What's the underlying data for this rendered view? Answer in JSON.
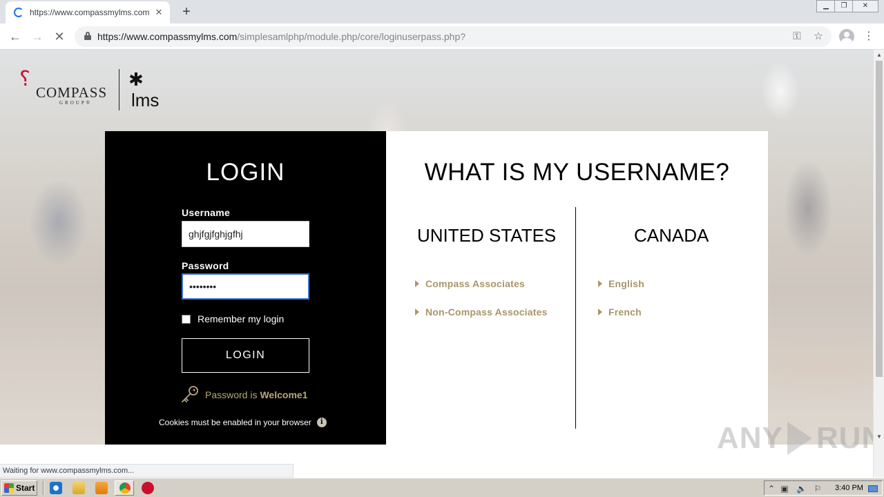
{
  "browser": {
    "tab_title": "https://www.compassmylms.com/simplesamlphp/module.php/core/loginuserpass.php?",
    "url_host": "https://www.compassmylms.com",
    "url_path": "/simplesamlphp/module.php/core/loginuserpass.php?",
    "status_text": "Waiting for www.compassmylms.com..."
  },
  "logo": {
    "company_word": "COMPASS",
    "company_sub": "GROUP®",
    "lms_word": "lms"
  },
  "login": {
    "title": "LOGIN",
    "username_label": "Username",
    "username_value": "ghjfgjfghjgfhj",
    "password_label": "Password",
    "password_value": "••••••••",
    "remember_label": "Remember my login",
    "button_label": "LOGIN",
    "hint_prefix": "Password is",
    "hint_value": "Welcome1",
    "cookies_text": "Cookies must be enabled in your browser"
  },
  "username_help": {
    "title": "WHAT IS MY USERNAME?",
    "regions": [
      {
        "name": "UNITED STATES",
        "links": [
          "Compass Associates",
          "Non-Compass Associates"
        ]
      },
      {
        "name": "CANADA",
        "links": [
          "English",
          "French"
        ]
      }
    ]
  },
  "watermark": {
    "left": "ANY",
    "right": "RUN"
  },
  "taskbar": {
    "start_label": "Start",
    "clock": "3:40 PM"
  },
  "colors": {
    "accent_gold": "#a8956a",
    "login_bg": "#000000",
    "focus_blue": "#3b73c9"
  }
}
